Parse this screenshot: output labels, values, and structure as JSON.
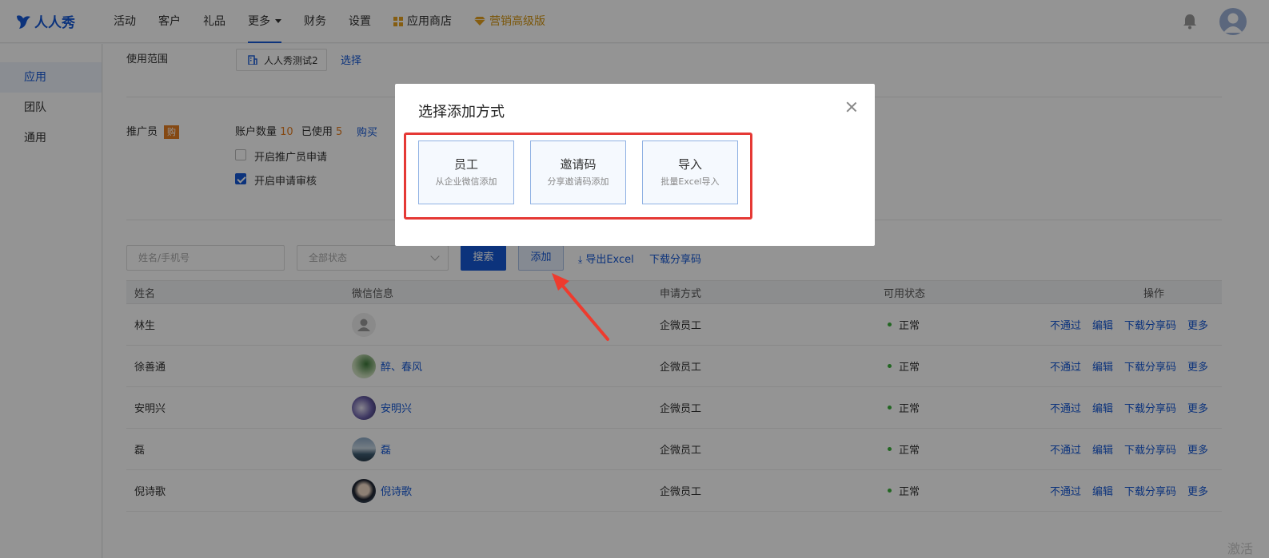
{
  "header": {
    "brand": "人人秀",
    "nav": [
      "活动",
      "客户",
      "礼品",
      "更多",
      "财务",
      "设置",
      "应用商店",
      "营销高级版"
    ]
  },
  "sidebar": {
    "items": [
      "应用",
      "团队",
      "通用"
    ]
  },
  "settings": {
    "scope_label": "使用范围",
    "scope_value": "人人秀测试2",
    "scope_link": "选择",
    "promoter_label": "推广员",
    "promoter_badge": "购",
    "account_qty_label": "账户数量",
    "account_qty_value": "10",
    "used_label": "已使用",
    "used_value": "5",
    "buy_link": "购买",
    "enable_apply_label": "开启推广员申请",
    "enable_review_label": "开启申请审核"
  },
  "toolbar": {
    "search_placeholder": "姓名/手机号",
    "status_select": "全部状态",
    "search_button": "搜索",
    "add_button": "添加",
    "export_link": "导出Excel",
    "download_code_link": "下载分享码"
  },
  "table": {
    "headers": [
      "姓名",
      "微信信息",
      "申请方式",
      "可用状态",
      "操作"
    ],
    "rows": [
      {
        "name": "林生",
        "wechat": "",
        "method": "企微员工",
        "status": "正常"
      },
      {
        "name": "徐善通",
        "wechat": "醉、春风",
        "method": "企微员工",
        "status": "正常"
      },
      {
        "name": "安明兴",
        "wechat": "安明兴",
        "method": "企微员工",
        "status": "正常"
      },
      {
        "name": "磊",
        "wechat": "磊",
        "method": "企微员工",
        "status": "正常"
      },
      {
        "name": "倪诗歌",
        "wechat": "倪诗歌",
        "method": "企微员工",
        "status": "正常"
      }
    ],
    "actions": [
      "不通过",
      "编辑",
      "下载分享码",
      "更多"
    ]
  },
  "modal": {
    "title": "选择添加方式",
    "options": [
      {
        "title": "员工",
        "subtitle": "从企业微信添加"
      },
      {
        "title": "邀请码",
        "subtitle": "分享邀请码添加"
      },
      {
        "title": "导入",
        "subtitle": "批量Excel导入"
      }
    ]
  },
  "watermark": "激活 W"
}
